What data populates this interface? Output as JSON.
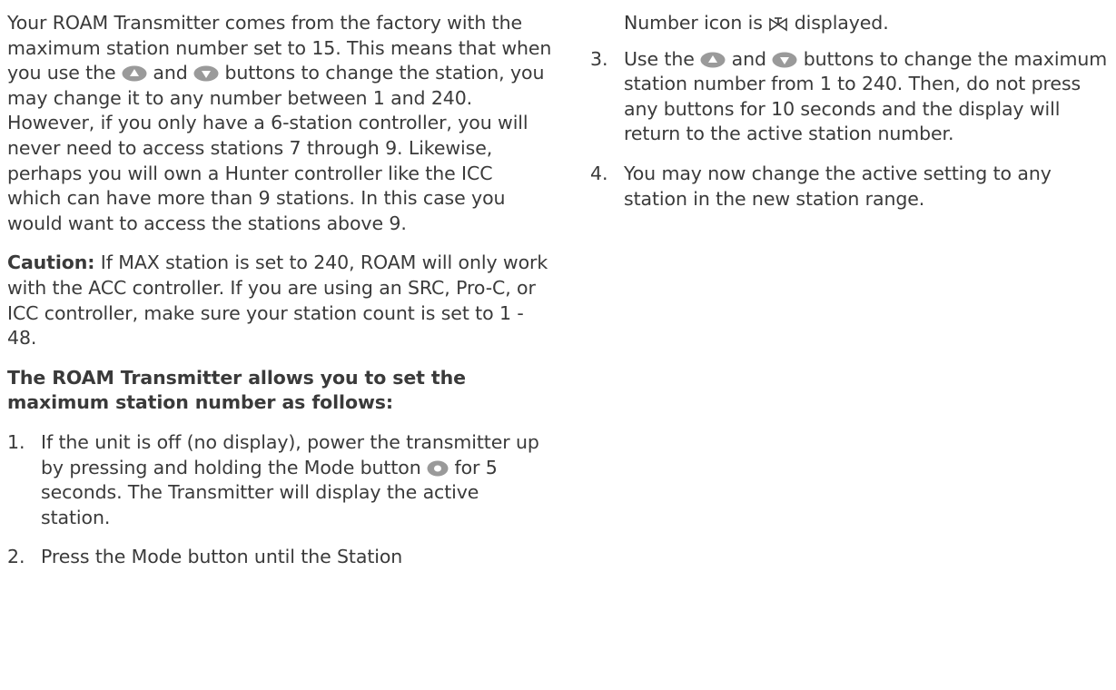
{
  "left_column": {
    "intro": [
      "Your ROAM Transmitter comes from the factory with the maximum station number set to 15. This means that when you use the ",
      " and ",
      " buttons to change the station, you may change it to any number between 1 and 240. However, if you only have a 6-station controller, you will never need to access stations 7 through 9. Likewise, perhaps you will own a Hunter controller like the ICC which can have more than 9 stations. In this case you would want to access the stations above 9."
    ],
    "caution_label": "Caution:",
    "caution_text": " If MAX station is set to 240, ROAM will only work with the ACC controller. If you are using an SRC, Pro-C, or ICC controller, make sure your station count is set to 1 - 48.",
    "subheading": "The ROAM Transmitter allows you to set the maximum station number as follows:",
    "step1": {
      "number": "1.",
      "text_before": "If the unit is off (no display), power the transmitter up by pressing and holding the Mode button ",
      "text_after": " for 5 seconds. The Transmitter will display the active station."
    },
    "step2": {
      "number": "2.",
      "text": "Press the Mode button until the Station"
    }
  },
  "right_column": {
    "step2_continued_before": "Number icon is ",
    "step2_continued_after": " displayed.",
    "step3": {
      "number": "3.",
      "text_before": "Use the ",
      "text_mid": " and ",
      "text_after": " buttons to change the maximum station number from 1 to 240. Then, do not press any buttons for 10 seconds and the display will return to the active station number."
    },
    "step4": {
      "number": "4.",
      "text": "You may now change the active setting to any station in the new station range."
    }
  },
  "icons": {
    "up_button": "up-arrow-button-icon",
    "down_button": "down-arrow-button-icon",
    "mode_button": "mode-button-icon",
    "station_number": "station-valve-icon",
    "button_fill": "#9a9a9a",
    "arrow_fill": "#ffffff"
  }
}
